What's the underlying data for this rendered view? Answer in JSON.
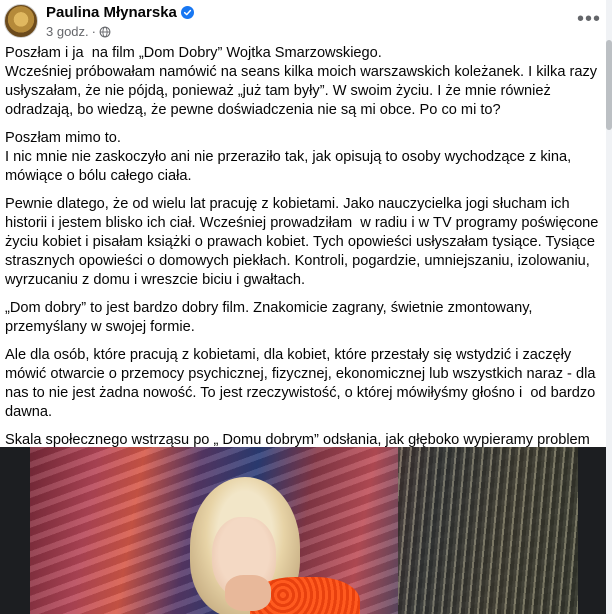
{
  "post": {
    "author": "Paulina Młynarska",
    "timestamp": "3 godz.",
    "icons": {
      "verified": "verified-badge-icon",
      "audience": "globe-icon",
      "more": "more-options-icon"
    },
    "accent_color": "#1877f2",
    "paragraphs": [
      "Poszłam i ja  na film „Dom Dobry” Wojtka Smarzowskiego.\nWcześniej próbowałam namówić na seans kilka moich warszawskich koleżanek. I kilka razy usłyszałam, że nie pójdą, ponieważ „już tam były”. W swoim życiu. I że mnie również odradzają, bo wiedzą, że pewne doświadczenia nie są mi obce. Po co mi to?",
      "Poszłam mimo to.\nI nic mnie nie zaskoczyło ani nie przeraziło tak, jak opisują to osoby wychodzące z kina, mówiące o bólu całego ciała.",
      "Pewnie dlatego, że od wielu lat pracuję z kobietami. Jako nauczycielka jogi słucham ich historii i jestem blisko ich ciał. Wcześniej prowadziłam  w radiu i w TV programy poświęcone życiu kobiet i pisałam książki o prawach kobiet. Tych opowieści usłyszałam tysiące. Tysiące strasznych opowieści o domowych piekłach. Kontroli, pogardzie, umniejszaniu, izolowaniu, wyrzucaniu z domu i wreszcie biciu i gwałtach.",
      "„Dom dobry” to jest bardzo dobry film. Znakomicie zagrany, świetnie zmontowany, przemyślany w swojej formie.",
      "Ale dla osób, które pracują z kobietami, dla kobiet, które przestały się wstydzić i zaczęły mówić otwarcie o przemocy psychicznej, fizycznej, ekonomicznej lub wszystkich naraz - dla nas to nie jest żadna nowość. To jest rzeczywistość, o której mówiłyśmy głośno i  od bardzo dawna.",
      "Skala społecznego wstrząsu po „ Domu dobrym” odsłania, jak głęboko wypieramy problem przemocy domowej. Jak bardzo nie chcemy dostrzec tego, co przecież wszyscy doskonale wiemy.\nTo, że tak wiele osób deklaruje szok, świadczy przede wszystkim o sile  zbiorowego wyparcia."
    ]
  }
}
